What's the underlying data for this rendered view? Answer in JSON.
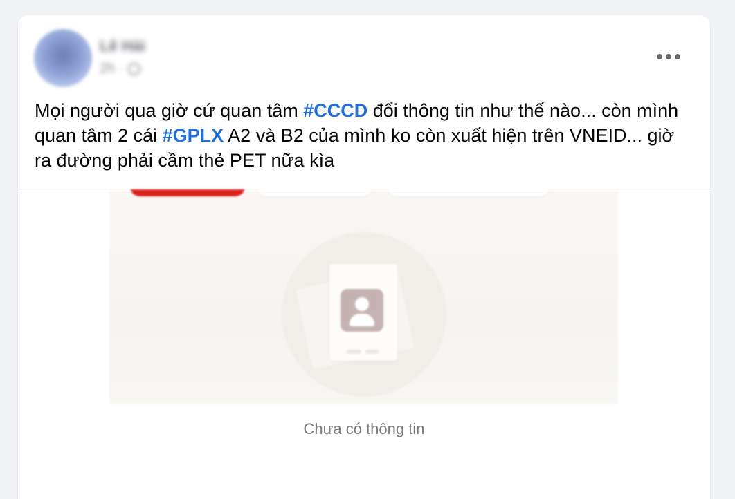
{
  "post": {
    "author_name": "Lê Hải",
    "timestamp": "2h",
    "privacy_icon": "globe-icon",
    "more_icon": "more-horizontal-icon",
    "text_parts": [
      "Mọi người qua giờ cứ quan tâm ",
      "#CCCD",
      " đổi thông tin như thế nào... còn mình quan tâm 2 cái ",
      "#GPLX",
      " A2 và B2 của mình ko còn xuất hiện trên VNEID... giờ ra đường phải cầm thẻ PET nữa kìa"
    ],
    "hashtags": [
      "#CCCD",
      "#GPLX"
    ]
  },
  "media": {
    "empty_state_label": "Chưa có thông tin",
    "empty_state_icon": "person-card-icon"
  },
  "colors": {
    "hashtag": "#216fdb",
    "tab_active": "#d9221d",
    "background": "#f0f2f5"
  }
}
